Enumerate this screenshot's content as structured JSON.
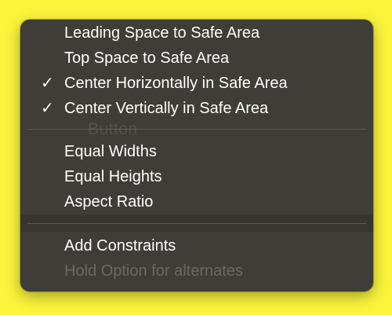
{
  "menu": {
    "group1": [
      {
        "label": "Leading Space to Safe Area",
        "checked": false
      },
      {
        "label": "Top Space to Safe Area",
        "checked": false
      },
      {
        "label": "Center Horizontally in Safe Area",
        "checked": true
      },
      {
        "label": "Center Vertically in Safe Area",
        "checked": true
      }
    ],
    "group2": [
      {
        "label": "Equal Widths"
      },
      {
        "label": "Equal Heights"
      },
      {
        "label": "Aspect Ratio"
      }
    ],
    "group3": [
      {
        "label": "Add Constraints",
        "enabled": true
      },
      {
        "label": "Hold Option for alternates",
        "enabled": false
      }
    ],
    "check_glyph": "✓"
  },
  "background_text": "Button",
  "colors": {
    "page_background": "#faf43c",
    "menu_background": "#3e3d37",
    "text": "#ffffff",
    "disabled_text": "#6a6963",
    "separator": "#5d5c56"
  }
}
